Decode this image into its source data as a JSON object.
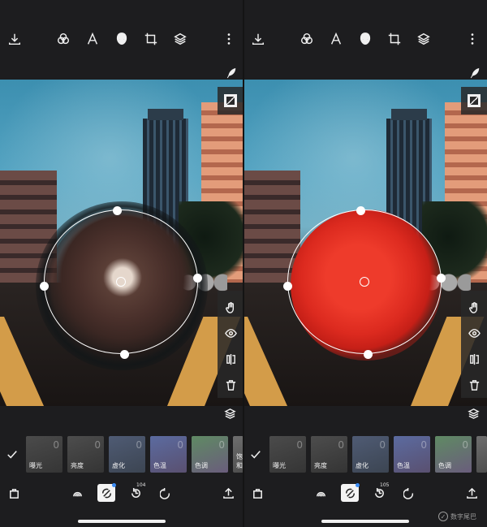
{
  "panels": [
    {
      "id": "left",
      "brush_style": "texture",
      "tiles": [
        {
          "label": "曝光",
          "value": "0"
        },
        {
          "label": "亮度",
          "value": "0"
        },
        {
          "label": "虚化",
          "value": "0"
        },
        {
          "label": "色温",
          "value": "0"
        },
        {
          "label": "色调",
          "value": "0"
        },
        {
          "label": "饱和",
          "value": ""
        }
      ],
      "history_count": "104"
    },
    {
      "id": "right",
      "brush_style": "red-mask",
      "tiles": [
        {
          "label": "曝光",
          "value": "0"
        },
        {
          "label": "亮度",
          "value": "0"
        },
        {
          "label": "虚化",
          "value": "0"
        },
        {
          "label": "色温",
          "value": "0"
        },
        {
          "label": "色调",
          "value": "0"
        },
        {
          "label": "",
          "value": ""
        }
      ],
      "history_count": "105"
    }
  ],
  "toolbar_icons": [
    "download-icon",
    "filters-icon",
    "text-icon",
    "brush-face-icon",
    "crop-icon",
    "layers-icon",
    "more-icon"
  ],
  "rail_icons": [
    "hand-icon",
    "eye-icon",
    "compare-icon",
    "delete-icon"
  ],
  "bottom_icons": [
    "bag-icon",
    "swirl-icon",
    "eraser-icon",
    "history-icon",
    "undo-icon",
    "share-icon"
  ],
  "colors": {
    "background": "#1d1d1f",
    "accent_dot": "#3b8cf5",
    "mask_red": "#e53a2a"
  },
  "watermark": "数字尾巴"
}
